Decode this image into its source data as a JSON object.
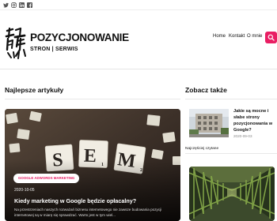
{
  "top_bar": {
    "social_icons": [
      "twitter-icon",
      "instagram-icon",
      "linkedin-icon",
      "facebook-icon"
    ]
  },
  "header": {
    "logo_title": "POZYCJONOWANIE",
    "logo_subtitle": "STRON | SERWIS",
    "nav": [
      "Home",
      "Kontakt",
      "O mnie"
    ],
    "accent_color": "#e91e63"
  },
  "main": {
    "section_title": "Najlepsze artykuły",
    "featured_post": {
      "category": "GOOGLE ADWORDS MARKETING",
      "date": "2020-10-05",
      "title": "Kiedy marketing w Google będzie opłacalny?",
      "excerpt": "Na przestrzeniach naszych rozważań biznesu internetowego nie zawsze budowania pozycji internetowej są w miarę się sprawdzać. Warto jest w tym wiel..."
    }
  },
  "sidebar": {
    "section_title": "Zobacz także",
    "posts": [
      {
        "title": "Jakie są mocne i słabe strony pozycjonowania w Google?",
        "date": "2020-09-03"
      }
    ],
    "popular_label": "Najczęściej czytane"
  }
}
